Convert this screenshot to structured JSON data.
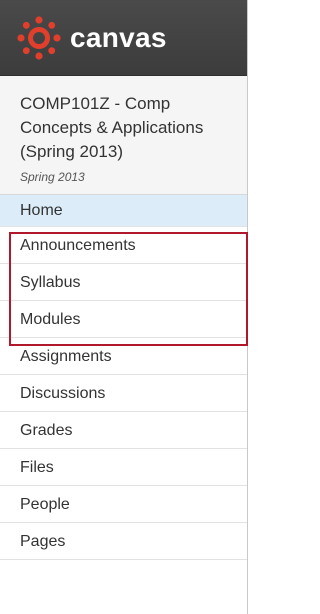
{
  "app": {
    "name": "canvas",
    "brand_color": "#e13f2b"
  },
  "course": {
    "title": "COMP101Z - Comp Concepts & Applications (Spring 2013)",
    "term": "Spring 2013"
  },
  "nav": {
    "active": "Home",
    "items": [
      {
        "label": "Home"
      },
      {
        "label": "Announcements"
      },
      {
        "label": "Syllabus"
      },
      {
        "label": "Modules"
      },
      {
        "label": "Assignments"
      },
      {
        "label": "Discussions"
      },
      {
        "label": "Grades"
      },
      {
        "label": "Files"
      },
      {
        "label": "People"
      },
      {
        "label": "Pages"
      }
    ]
  },
  "highlight": {
    "color": "#b2182b",
    "covers": [
      "Announcements",
      "Syllabus",
      "Modules"
    ]
  }
}
